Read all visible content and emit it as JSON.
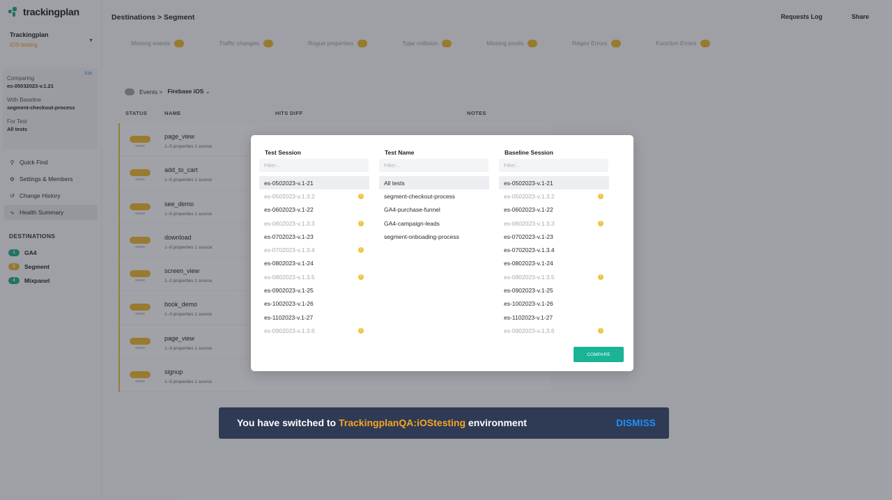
{
  "app": {
    "logo_text": "trackingplan"
  },
  "workspace": {
    "name": "Trackingplan",
    "environment": "iOS-testing"
  },
  "compare_box": {
    "edit_label": "Edit",
    "comparing_label": "Comparing",
    "comparing_value": "es-05032023-v.1.21",
    "baseline_label": "With Baseline",
    "baseline_value": "segment-checkout-process",
    "fortest_label": "For Test",
    "fortest_value": "All tests"
  },
  "nav": {
    "items": [
      {
        "label": "Quick Find",
        "icon": "search-icon"
      },
      {
        "label": "Settings & Members",
        "icon": "gear-icon"
      },
      {
        "label": "Change History",
        "icon": "history-icon"
      },
      {
        "label": "Health Summary",
        "icon": "pulse-icon"
      }
    ]
  },
  "destinations": {
    "title": "DESTINATIONS",
    "items": [
      {
        "label": "GA4",
        "badge": "1",
        "color": "#1fa58a"
      },
      {
        "label": "Segment",
        "badge": "0",
        "color": "#e0b13a"
      },
      {
        "label": "Mixpanel",
        "badge": "4",
        "color": "#1fa58a"
      }
    ]
  },
  "header": {
    "breadcrumb": "Destinations > Segment",
    "requests_log": "Requests Log",
    "share": "Share"
  },
  "issue_tabs": [
    {
      "label": "Missing events"
    },
    {
      "label": "Traffic changes"
    },
    {
      "label": "Rogue properties"
    },
    {
      "label": "Type collision"
    },
    {
      "label": "Missing pixels"
    },
    {
      "label": "Regex Errors"
    },
    {
      "label": "Function Errors"
    }
  ],
  "events_filter": {
    "prefix": "Events >",
    "source": "Firebase iOS"
  },
  "table": {
    "headers": {
      "status": "STATUS",
      "name": "NAME",
      "hits_diff": "HITS DIFF",
      "notes": "NOTES"
    },
    "rows": [
      {
        "name": "page_view",
        "props": "1–5 properties 1 source"
      },
      {
        "name": "add_to_cart",
        "props": "1–5 properties 1 source"
      },
      {
        "name": "see_demo",
        "props": "1–5 properties 1 source"
      },
      {
        "name": "download",
        "props": "1–9 properties 1 source"
      },
      {
        "name": "screen_view",
        "props": "1–2 properties 1 source"
      },
      {
        "name": "book_demo",
        "props": "1–3 properties 1 source"
      },
      {
        "name": "page_view",
        "props": "1–3 properties 1 source"
      },
      {
        "name": "signup",
        "props": "1–5 properties 1 source"
      }
    ]
  },
  "modal": {
    "test_session": {
      "title": "Test Session",
      "placeholder": "Filter...",
      "options": [
        {
          "label": "es-0502023-v.1-21",
          "muted": false,
          "warn": false,
          "selected": true
        },
        {
          "label": "es-0502023-v.1.3.2",
          "muted": true,
          "warn": true,
          "selected": false
        },
        {
          "label": "es-0602023-v.1-22",
          "muted": false,
          "warn": false,
          "selected": false
        },
        {
          "label": "es-0602023-v.1.3.3",
          "muted": true,
          "warn": true,
          "selected": false
        },
        {
          "label": "es-0702023-v.1-23",
          "muted": false,
          "warn": false,
          "selected": false
        },
        {
          "label": "es-0702023-v.1.3.4",
          "muted": true,
          "warn": true,
          "selected": false
        },
        {
          "label": "es-0802023-v.1-24",
          "muted": false,
          "warn": false,
          "selected": false
        },
        {
          "label": "es-0802023-v.1.3.5",
          "muted": true,
          "warn": true,
          "selected": false
        },
        {
          "label": "es-0902023-v.1-25",
          "muted": false,
          "warn": false,
          "selected": false
        },
        {
          "label": "es-1002023-v.1-26",
          "muted": false,
          "warn": false,
          "selected": false
        },
        {
          "label": "es-1102023-v.1-27",
          "muted": false,
          "warn": false,
          "selected": false
        },
        {
          "label": "es-0902023-v.1.3.6",
          "muted": true,
          "warn": true,
          "selected": false
        }
      ]
    },
    "test_name": {
      "title": "Test Name",
      "placeholder": "Filter...",
      "options": [
        {
          "label": "All tests",
          "muted": false,
          "warn": false,
          "selected": true
        },
        {
          "label": "segment-checkout-process",
          "muted": false,
          "warn": false,
          "selected": false
        },
        {
          "label": "GA4-purchase-funnel",
          "muted": false,
          "warn": false,
          "selected": false
        },
        {
          "label": "GA4-campaign-leads",
          "muted": false,
          "warn": false,
          "selected": false
        },
        {
          "label": "segment-onboading-process",
          "muted": false,
          "warn": false,
          "selected": false
        }
      ]
    },
    "baseline_session": {
      "title": "Baseline Session",
      "placeholder": "Filter...",
      "options": [
        {
          "label": "es-0502023-v.1-21",
          "muted": false,
          "warn": false,
          "selected": true
        },
        {
          "label": "es-0502023-v.1.3.2",
          "muted": true,
          "warn": true,
          "selected": false
        },
        {
          "label": "es-0602023-v.1-22",
          "muted": false,
          "warn": false,
          "selected": false
        },
        {
          "label": "es-0602023-v.1.3.3",
          "muted": true,
          "warn": true,
          "selected": false
        },
        {
          "label": "es-0702023-v.1-23",
          "muted": false,
          "warn": false,
          "selected": false
        },
        {
          "label": "es-0702023-v.1.3.4",
          "muted": false,
          "warn": false,
          "selected": false
        },
        {
          "label": "es-0802023-v.1-24",
          "muted": false,
          "warn": false,
          "selected": false
        },
        {
          "label": "es-0802023-v.1.3.5",
          "muted": true,
          "warn": true,
          "selected": false
        },
        {
          "label": "es-0902023-v.1-25",
          "muted": false,
          "warn": false,
          "selected": false
        },
        {
          "label": "es-1002023-v.1-26",
          "muted": false,
          "warn": false,
          "selected": false
        },
        {
          "label": "es-1102023-v.1-27",
          "muted": false,
          "warn": false,
          "selected": false
        },
        {
          "label": "es-0902023-v.1.3.6",
          "muted": true,
          "warn": true,
          "selected": false
        }
      ]
    },
    "compare_label": "COMPARE"
  },
  "toast": {
    "prefix": "You have switched to",
    "environment": "TrackingplanQA:iOStesting",
    "suffix": "environment",
    "dismiss_label": "DISMISS"
  },
  "colors": {
    "accent": "#19b396",
    "warning": "#e9b52e",
    "toast_bg": "#2f3a55",
    "toast_highlight": "#f5a623",
    "dismiss": "#1e90ff"
  }
}
